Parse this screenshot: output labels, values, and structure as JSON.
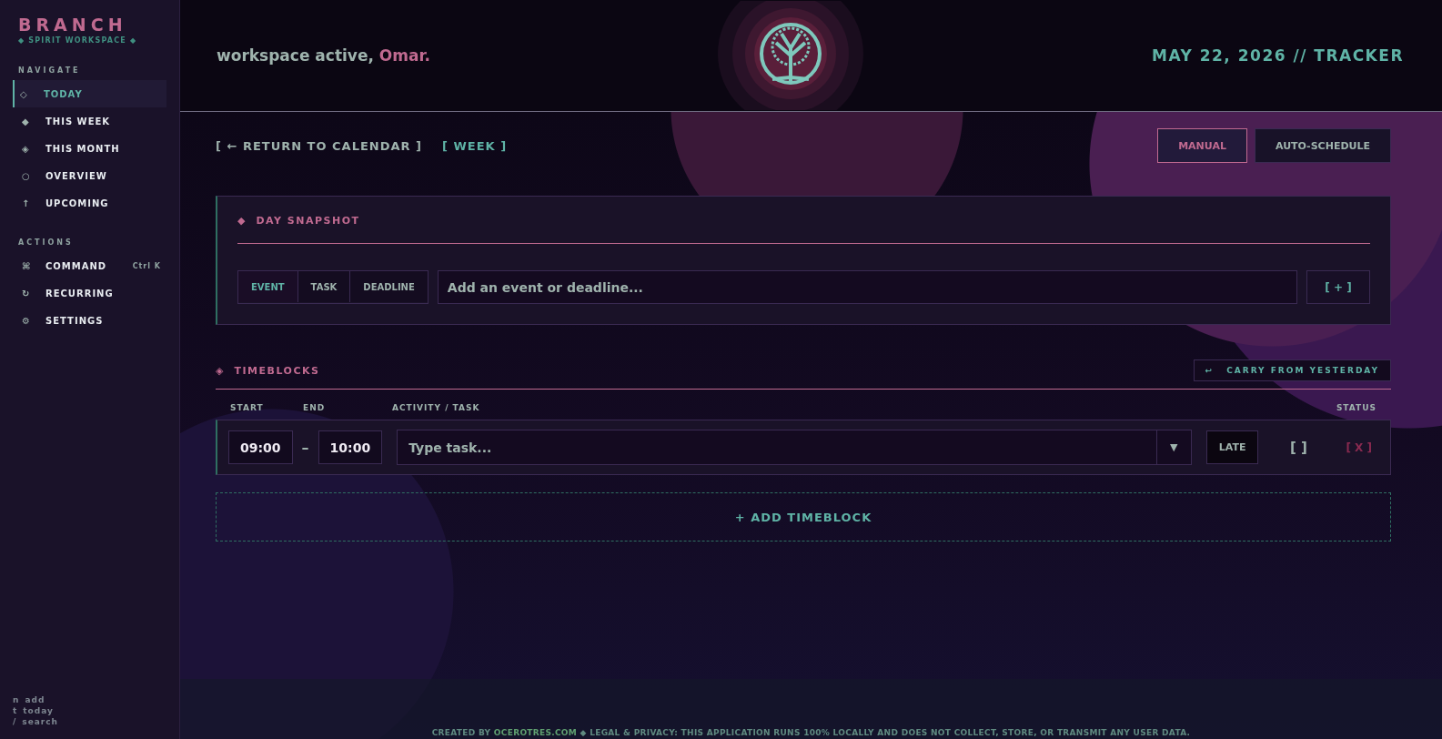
{
  "sidebar": {
    "brand": "BRANCH",
    "tagline": "◆ SPIRIT WORKSPACE ◆",
    "sections": [
      {
        "title": "NAVIGATE",
        "items": [
          {
            "icon": "◇",
            "label": "TODAY",
            "selected": true
          },
          {
            "icon": "◆",
            "label": "THIS WEEK",
            "selected": false
          },
          {
            "icon": "◈",
            "label": "THIS MONTH",
            "selected": false
          },
          {
            "icon": "○",
            "label": "OVERVIEW",
            "selected": false
          },
          {
            "icon": "↑",
            "label": "UPCOMING",
            "selected": false
          }
        ]
      },
      {
        "title": "ACTIONS",
        "items": [
          {
            "icon": "⌘",
            "label": "COMMAND",
            "shortcut": "Ctrl K",
            "selected": false
          },
          {
            "icon": "↻",
            "label": "RECURRING",
            "selected": false
          },
          {
            "icon": "⚙",
            "label": "SETTINGS",
            "selected": false
          }
        ]
      }
    ],
    "hotkeys": [
      {
        "key": "n",
        "label": "add"
      },
      {
        "key": "t",
        "label": "today"
      },
      {
        "key": "/",
        "label": "search"
      }
    ]
  },
  "header": {
    "greeting": "workspace active, ",
    "name": "Omar.",
    "date": "MAY 22, 2026 // TRACKER"
  },
  "toolbar": {
    "back_link": "[ ← RETURN TO CALENDAR ]",
    "week_link": "[ WEEK ]",
    "modes": [
      {
        "label": "MANUAL",
        "selected": true
      },
      {
        "label": "AUTO-SCHEDULE",
        "selected": false
      }
    ]
  },
  "snapshot": {
    "icon": "◆",
    "title": "DAY SNAPSHOT",
    "types": [
      {
        "label": "EVENT",
        "selected": true
      },
      {
        "label": "TASK",
        "selected": false
      },
      {
        "label": "DEADLINE",
        "selected": false
      }
    ],
    "placeholder": "Add an event or deadline...",
    "add_button": "[ + ]"
  },
  "timeblocks": {
    "icon": "◈",
    "title": "TIMEBLOCKS",
    "carry_icon": "↩",
    "carry_button": "CARRY FROM YESTERDAY",
    "columns": [
      "START",
      "END",
      "ACTIVITY / TASK",
      "STATUS"
    ],
    "rows": [
      {
        "start": "09:00",
        "separator": "–",
        "end": "10:00",
        "placeholder": "Type task...",
        "caret": "▼",
        "status": "LATE",
        "check": "[ ]",
        "checked": false,
        "delete": "[ X ]"
      }
    ],
    "add_button": "+ ADD TIMEBLOCK"
  },
  "footer": {
    "credit": "CREATED BY ",
    "site": "OCEROTRES.COM",
    "separator": "◆",
    "legal": "LEGAL & PRIVACY: THIS APPLICATION RUNS 100% LOCALLY AND DOES NOT COLLECT, STORE, OR TRANSMIT ANY USER DATA."
  }
}
